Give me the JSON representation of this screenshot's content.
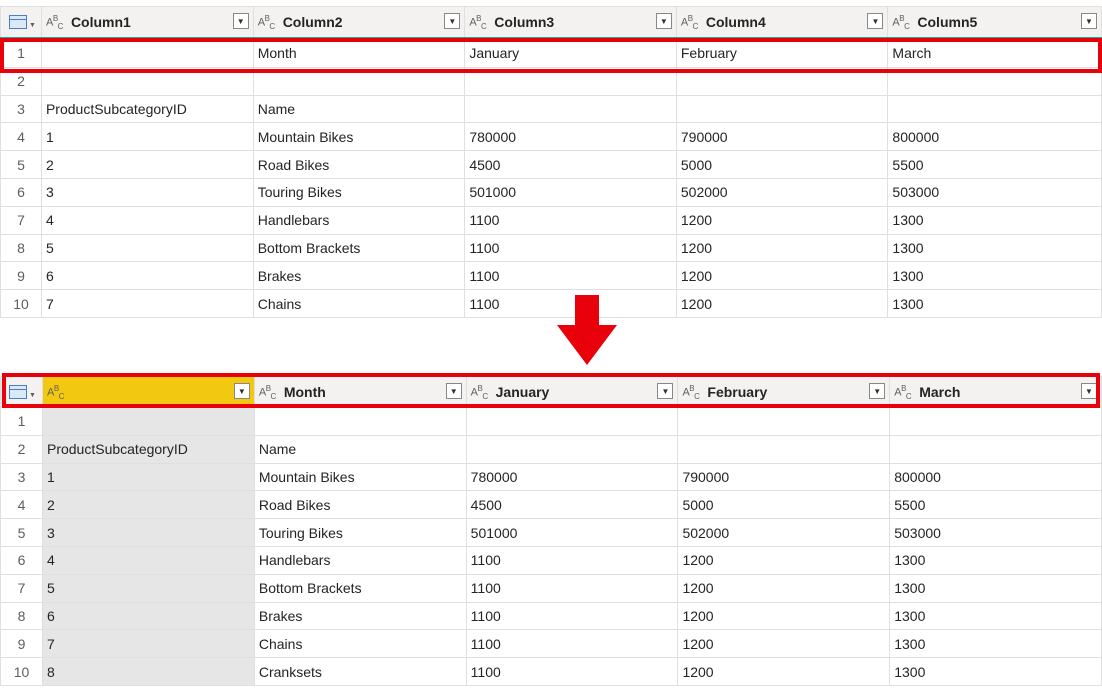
{
  "top_table": {
    "columns": [
      "Column1",
      "Column2",
      "Column3",
      "Column4",
      "Column5"
    ],
    "type_icon": "ABC",
    "rows": [
      {
        "n": "1",
        "cells": [
          "",
          "Month",
          "January",
          "February",
          "March"
        ]
      },
      {
        "n": "2",
        "cells": [
          "",
          "",
          "",
          "",
          ""
        ]
      },
      {
        "n": "3",
        "cells": [
          "ProductSubcategoryID",
          "Name",
          "",
          "",
          ""
        ]
      },
      {
        "n": "4",
        "cells": [
          "1",
          "Mountain Bikes",
          "780000",
          "790000",
          "800000"
        ]
      },
      {
        "n": "5",
        "cells": [
          "2",
          "Road Bikes",
          "4500",
          "5000",
          "5500"
        ]
      },
      {
        "n": "6",
        "cells": [
          "3",
          "Touring Bikes",
          "501000",
          "502000",
          "503000"
        ]
      },
      {
        "n": "7",
        "cells": [
          "4",
          "Handlebars",
          "1100",
          "1200",
          "1300"
        ]
      },
      {
        "n": "8",
        "cells": [
          "5",
          "Bottom Brackets",
          "1100",
          "1200",
          "1300"
        ]
      },
      {
        "n": "9",
        "cells": [
          "6",
          "Brakes",
          "1100",
          "1200",
          "1300"
        ]
      },
      {
        "n": "10",
        "cells": [
          "7",
          "Chains",
          "1100",
          "1200",
          "1300"
        ]
      }
    ]
  },
  "bottom_table": {
    "columns": [
      "",
      "Month",
      "January",
      "February",
      "March"
    ],
    "type_icon": "ABC",
    "rows": [
      {
        "n": "1",
        "cells": [
          "",
          "",
          "",
          "",
          ""
        ]
      },
      {
        "n": "2",
        "cells": [
          "ProductSubcategoryID",
          "Name",
          "",
          "",
          ""
        ]
      },
      {
        "n": "3",
        "cells": [
          "1",
          "Mountain Bikes",
          "780000",
          "790000",
          "800000"
        ]
      },
      {
        "n": "4",
        "cells": [
          "2",
          "Road Bikes",
          "4500",
          "5000",
          "5500"
        ]
      },
      {
        "n": "5",
        "cells": [
          "3",
          "Touring Bikes",
          "501000",
          "502000",
          "503000"
        ]
      },
      {
        "n": "6",
        "cells": [
          "4",
          "Handlebars",
          "1100",
          "1200",
          "1300"
        ]
      },
      {
        "n": "7",
        "cells": [
          "5",
          "Bottom Brackets",
          "1100",
          "1200",
          "1300"
        ]
      },
      {
        "n": "8",
        "cells": [
          "6",
          "Brakes",
          "1100",
          "1200",
          "1300"
        ]
      },
      {
        "n": "9",
        "cells": [
          "7",
          "Chains",
          "1100",
          "1200",
          "1300"
        ]
      },
      {
        "n": "10",
        "cells": [
          "8",
          "Cranksets",
          "1100",
          "1200",
          "1300"
        ]
      }
    ]
  },
  "colors": {
    "highlight": "#e8000b",
    "selected_column": "#f2c811",
    "header_underline": "#25a79c"
  }
}
